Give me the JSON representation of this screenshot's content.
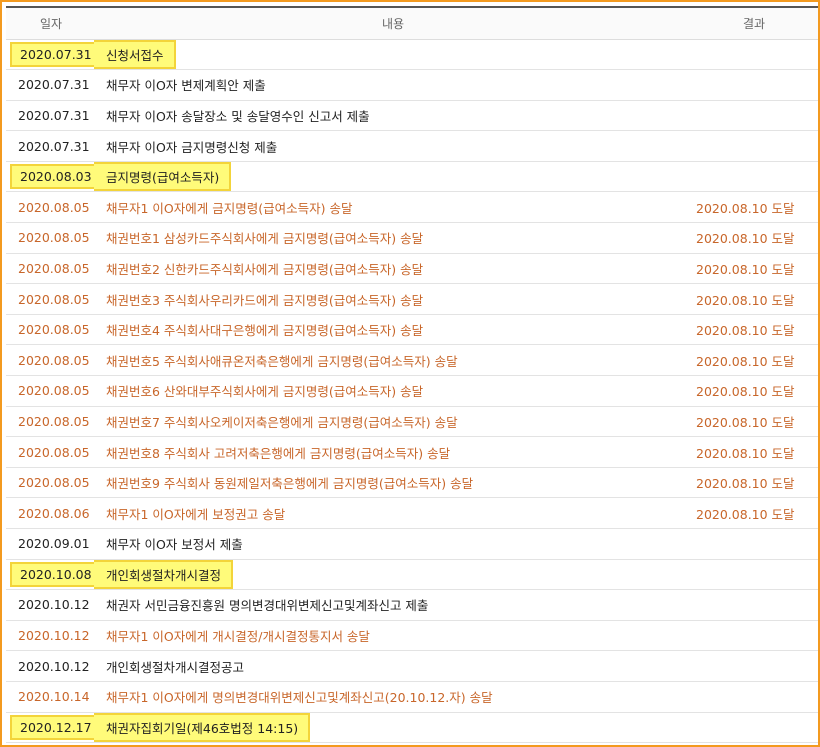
{
  "headers": {
    "date": "일자",
    "content": "내용",
    "result": "결과"
  },
  "rows": [
    {
      "date": "2020.07.31",
      "content": "신청서접수",
      "result": "",
      "style": "black",
      "highlight": true
    },
    {
      "date": "2020.07.31",
      "content": "채무자 이O자 변제계획안 제출",
      "result": "",
      "style": "black",
      "highlight": false
    },
    {
      "date": "2020.07.31",
      "content": "채무자 이O자 송달장소 및 송달영수인 신고서 제출",
      "result": "",
      "style": "black",
      "highlight": false
    },
    {
      "date": "2020.07.31",
      "content": "채무자 이O자 금지명령신청 제출",
      "result": "",
      "style": "black",
      "highlight": false
    },
    {
      "date": "2020.08.03",
      "content": "금지명령(급여소득자)",
      "result": "",
      "style": "black",
      "highlight": true
    },
    {
      "date": "2020.08.05",
      "content": "채무자1 이O자에게 금지명령(급여소득자) 송달",
      "result": "2020.08.10 도달",
      "style": "orange",
      "highlight": false
    },
    {
      "date": "2020.08.05",
      "content": "채권번호1 삼성카드주식회사에게 금지명령(급여소득자) 송달",
      "result": "2020.08.10 도달",
      "style": "orange",
      "highlight": false
    },
    {
      "date": "2020.08.05",
      "content": "채권번호2 신한카드주식회사에게 금지명령(급여소득자) 송달",
      "result": "2020.08.10 도달",
      "style": "orange",
      "highlight": false
    },
    {
      "date": "2020.08.05",
      "content": "채권번호3 주식회사우리카드에게 금지명령(급여소득자) 송달",
      "result": "2020.08.10 도달",
      "style": "orange",
      "highlight": false
    },
    {
      "date": "2020.08.05",
      "content": "채권번호4 주식회사대구은행에게 금지명령(급여소득자) 송달",
      "result": "2020.08.10 도달",
      "style": "orange",
      "highlight": false
    },
    {
      "date": "2020.08.05",
      "content": "채권번호5 주식회사애큐온저축은행에게 금지명령(급여소득자) 송달",
      "result": "2020.08.10 도달",
      "style": "orange",
      "highlight": false
    },
    {
      "date": "2020.08.05",
      "content": "채권번호6 산와대부주식회사에게 금지명령(급여소득자) 송달",
      "result": "2020.08.10 도달",
      "style": "orange",
      "highlight": false
    },
    {
      "date": "2020.08.05",
      "content": "채권번호7 주식회사오케이저축은행에게 금지명령(급여소득자) 송달",
      "result": "2020.08.10 도달",
      "style": "orange",
      "highlight": false
    },
    {
      "date": "2020.08.05",
      "content": "채권번호8 주식회사 고려저축은행에게 금지명령(급여소득자) 송달",
      "result": "2020.08.10 도달",
      "style": "orange",
      "highlight": false
    },
    {
      "date": "2020.08.05",
      "content": "채권번호9 주식회사 동원제일저축은행에게 금지명령(급여소득자) 송달",
      "result": "2020.08.10 도달",
      "style": "orange",
      "highlight": false
    },
    {
      "date": "2020.08.06",
      "content": "채무자1 이O자에게 보정권고 송달",
      "result": "2020.08.10 도달",
      "style": "orange",
      "highlight": false
    },
    {
      "date": "2020.09.01",
      "content": "채무자 이O자 보정서 제출",
      "result": "",
      "style": "black",
      "highlight": false
    },
    {
      "date": "2020.10.08",
      "content": "개인회생절차개시결정",
      "result": "",
      "style": "black",
      "highlight": true
    },
    {
      "date": "2020.10.12",
      "content": "채권자 서민금융진흥원 명의변경대위변제신고및계좌신고 제출",
      "result": "",
      "style": "black",
      "highlight": false
    },
    {
      "date": "2020.10.12",
      "content": "채무자1 이O자에게 개시결정/개시결정통지서 송달",
      "result": "",
      "style": "orange",
      "highlight": false
    },
    {
      "date": "2020.10.12",
      "content": "개인회생절차개시결정공고",
      "result": "",
      "style": "black",
      "highlight": false
    },
    {
      "date": "2020.10.14",
      "content": "채무자1 이O자에게 명의변경대위변제신고및계좌신고(20.10.12.자) 송달",
      "result": "",
      "style": "orange",
      "highlight": false
    },
    {
      "date": "2020.12.17",
      "content": "채권자집회기일(제46호법정 14:15)",
      "result": "",
      "style": "black",
      "highlight": true
    }
  ]
}
